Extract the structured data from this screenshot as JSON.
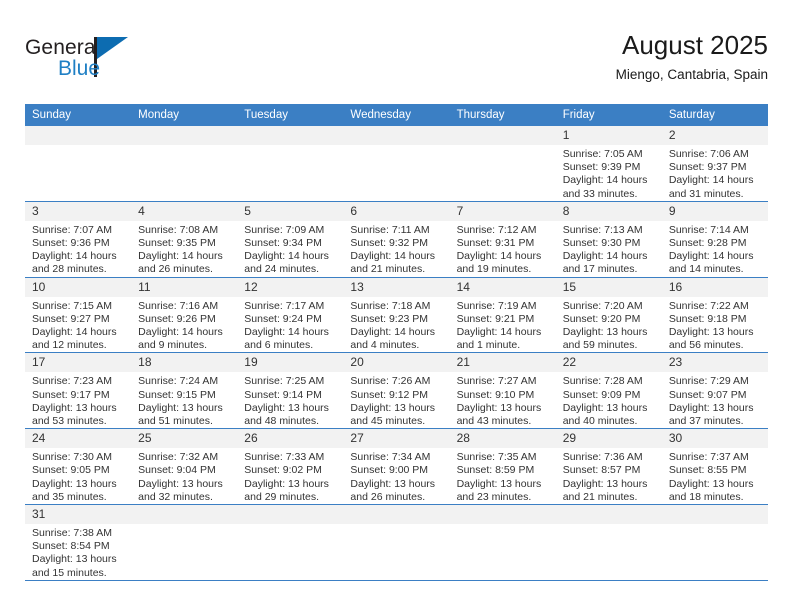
{
  "brand": {
    "name_part1": "General",
    "name_part2": "Blue",
    "flag_color": "#0d6cb1"
  },
  "header": {
    "title": "August 2025",
    "location": "Miengo, Cantabria, Spain"
  },
  "calendar": {
    "accent_color": "#3b7fc4",
    "daynum_band_color": "#f2f2f2",
    "weekdays": [
      "Sunday",
      "Monday",
      "Tuesday",
      "Wednesday",
      "Thursday",
      "Friday",
      "Saturday"
    ],
    "weeks": [
      [
        {
          "day": "",
          "lines": []
        },
        {
          "day": "",
          "lines": []
        },
        {
          "day": "",
          "lines": []
        },
        {
          "day": "",
          "lines": []
        },
        {
          "day": "",
          "lines": []
        },
        {
          "day": "1",
          "lines": [
            "Sunrise: 7:05 AM",
            "Sunset: 9:39 PM",
            "Daylight: 14 hours",
            "and 33 minutes."
          ]
        },
        {
          "day": "2",
          "lines": [
            "Sunrise: 7:06 AM",
            "Sunset: 9:37 PM",
            "Daylight: 14 hours",
            "and 31 minutes."
          ]
        }
      ],
      [
        {
          "day": "3",
          "lines": [
            "Sunrise: 7:07 AM",
            "Sunset: 9:36 PM",
            "Daylight: 14 hours",
            "and 28 minutes."
          ]
        },
        {
          "day": "4",
          "lines": [
            "Sunrise: 7:08 AM",
            "Sunset: 9:35 PM",
            "Daylight: 14 hours",
            "and 26 minutes."
          ]
        },
        {
          "day": "5",
          "lines": [
            "Sunrise: 7:09 AM",
            "Sunset: 9:34 PM",
            "Daylight: 14 hours",
            "and 24 minutes."
          ]
        },
        {
          "day": "6",
          "lines": [
            "Sunrise: 7:11 AM",
            "Sunset: 9:32 PM",
            "Daylight: 14 hours",
            "and 21 minutes."
          ]
        },
        {
          "day": "7",
          "lines": [
            "Sunrise: 7:12 AM",
            "Sunset: 9:31 PM",
            "Daylight: 14 hours",
            "and 19 minutes."
          ]
        },
        {
          "day": "8",
          "lines": [
            "Sunrise: 7:13 AM",
            "Sunset: 9:30 PM",
            "Daylight: 14 hours",
            "and 17 minutes."
          ]
        },
        {
          "day": "9",
          "lines": [
            "Sunrise: 7:14 AM",
            "Sunset: 9:28 PM",
            "Daylight: 14 hours",
            "and 14 minutes."
          ]
        }
      ],
      [
        {
          "day": "10",
          "lines": [
            "Sunrise: 7:15 AM",
            "Sunset: 9:27 PM",
            "Daylight: 14 hours",
            "and 12 minutes."
          ]
        },
        {
          "day": "11",
          "lines": [
            "Sunrise: 7:16 AM",
            "Sunset: 9:26 PM",
            "Daylight: 14 hours",
            "and 9 minutes."
          ]
        },
        {
          "day": "12",
          "lines": [
            "Sunrise: 7:17 AM",
            "Sunset: 9:24 PM",
            "Daylight: 14 hours",
            "and 6 minutes."
          ]
        },
        {
          "day": "13",
          "lines": [
            "Sunrise: 7:18 AM",
            "Sunset: 9:23 PM",
            "Daylight: 14 hours",
            "and 4 minutes."
          ]
        },
        {
          "day": "14",
          "lines": [
            "Sunrise: 7:19 AM",
            "Sunset: 9:21 PM",
            "Daylight: 14 hours",
            "and 1 minute."
          ]
        },
        {
          "day": "15",
          "lines": [
            "Sunrise: 7:20 AM",
            "Sunset: 9:20 PM",
            "Daylight: 13 hours",
            "and 59 minutes."
          ]
        },
        {
          "day": "16",
          "lines": [
            "Sunrise: 7:22 AM",
            "Sunset: 9:18 PM",
            "Daylight: 13 hours",
            "and 56 minutes."
          ]
        }
      ],
      [
        {
          "day": "17",
          "lines": [
            "Sunrise: 7:23 AM",
            "Sunset: 9:17 PM",
            "Daylight: 13 hours",
            "and 53 minutes."
          ]
        },
        {
          "day": "18",
          "lines": [
            "Sunrise: 7:24 AM",
            "Sunset: 9:15 PM",
            "Daylight: 13 hours",
            "and 51 minutes."
          ]
        },
        {
          "day": "19",
          "lines": [
            "Sunrise: 7:25 AM",
            "Sunset: 9:14 PM",
            "Daylight: 13 hours",
            "and 48 minutes."
          ]
        },
        {
          "day": "20",
          "lines": [
            "Sunrise: 7:26 AM",
            "Sunset: 9:12 PM",
            "Daylight: 13 hours",
            "and 45 minutes."
          ]
        },
        {
          "day": "21",
          "lines": [
            "Sunrise: 7:27 AM",
            "Sunset: 9:10 PM",
            "Daylight: 13 hours",
            "and 43 minutes."
          ]
        },
        {
          "day": "22",
          "lines": [
            "Sunrise: 7:28 AM",
            "Sunset: 9:09 PM",
            "Daylight: 13 hours",
            "and 40 minutes."
          ]
        },
        {
          "day": "23",
          "lines": [
            "Sunrise: 7:29 AM",
            "Sunset: 9:07 PM",
            "Daylight: 13 hours",
            "and 37 minutes."
          ]
        }
      ],
      [
        {
          "day": "24",
          "lines": [
            "Sunrise: 7:30 AM",
            "Sunset: 9:05 PM",
            "Daylight: 13 hours",
            "and 35 minutes."
          ]
        },
        {
          "day": "25",
          "lines": [
            "Sunrise: 7:32 AM",
            "Sunset: 9:04 PM",
            "Daylight: 13 hours",
            "and 32 minutes."
          ]
        },
        {
          "day": "26",
          "lines": [
            "Sunrise: 7:33 AM",
            "Sunset: 9:02 PM",
            "Daylight: 13 hours",
            "and 29 minutes."
          ]
        },
        {
          "day": "27",
          "lines": [
            "Sunrise: 7:34 AM",
            "Sunset: 9:00 PM",
            "Daylight: 13 hours",
            "and 26 minutes."
          ]
        },
        {
          "day": "28",
          "lines": [
            "Sunrise: 7:35 AM",
            "Sunset: 8:59 PM",
            "Daylight: 13 hours",
            "and 23 minutes."
          ]
        },
        {
          "day": "29",
          "lines": [
            "Sunrise: 7:36 AM",
            "Sunset: 8:57 PM",
            "Daylight: 13 hours",
            "and 21 minutes."
          ]
        },
        {
          "day": "30",
          "lines": [
            "Sunrise: 7:37 AM",
            "Sunset: 8:55 PM",
            "Daylight: 13 hours",
            "and 18 minutes."
          ]
        }
      ],
      [
        {
          "day": "31",
          "lines": [
            "Sunrise: 7:38 AM",
            "Sunset: 8:54 PM",
            "Daylight: 13 hours",
            "and 15 minutes."
          ]
        },
        {
          "day": "",
          "lines": []
        },
        {
          "day": "",
          "lines": []
        },
        {
          "day": "",
          "lines": []
        },
        {
          "day": "",
          "lines": []
        },
        {
          "day": "",
          "lines": []
        },
        {
          "day": "",
          "lines": []
        }
      ]
    ]
  }
}
